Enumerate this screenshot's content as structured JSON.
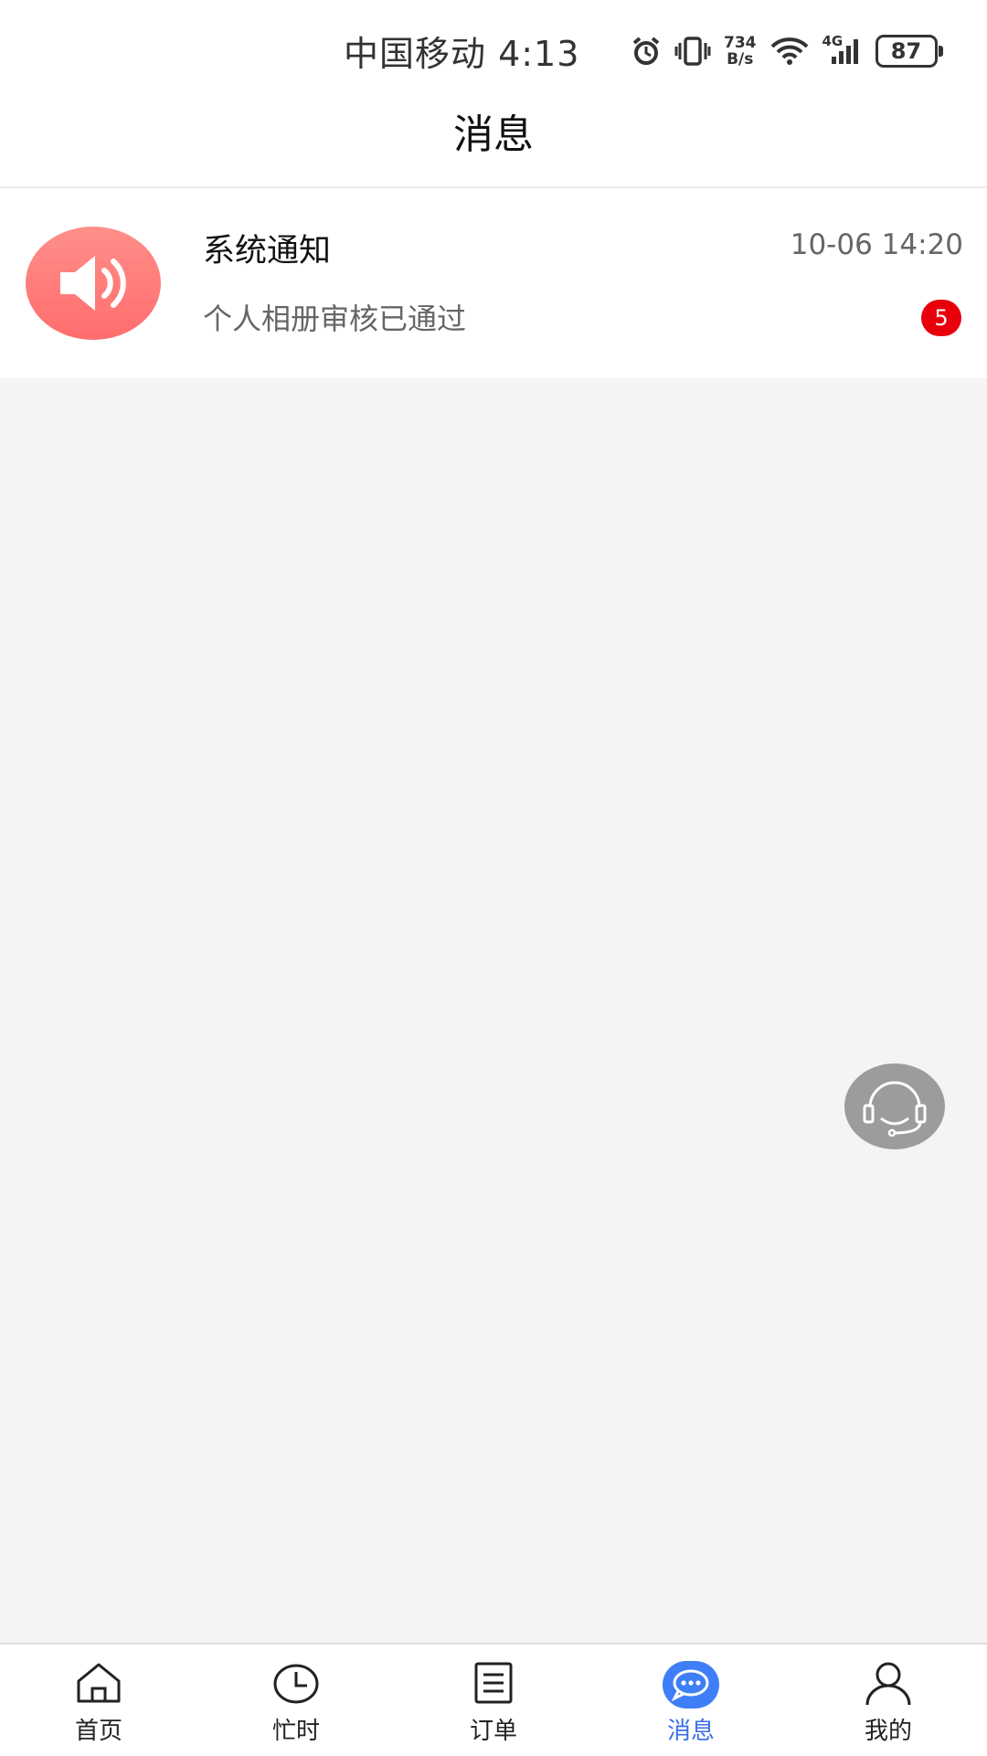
{
  "status_bar": {
    "carrier_time": "中国移动 4:13",
    "net_speed_value": "734",
    "net_speed_unit": "B/s",
    "network_type": "4G",
    "battery": "87",
    "icons": [
      "alarm-icon",
      "vibrate-icon",
      "wifi-icon",
      "signal-icon",
      "battery-icon"
    ]
  },
  "header": {
    "title": "消息"
  },
  "messages": [
    {
      "icon": "speaker-icon",
      "title": "系统通知",
      "time": "10-06 14:20",
      "preview": "个人相册审核已通过",
      "unread": "5"
    }
  ],
  "floating": {
    "icon": "headset-icon"
  },
  "tabs": [
    {
      "label": "首页",
      "icon": "home-icon"
    },
    {
      "label": "忙时",
      "icon": "clock-icon"
    },
    {
      "label": "订单",
      "icon": "list-icon"
    },
    {
      "label": "消息",
      "icon": "chat-bubble-icon",
      "active": true
    },
    {
      "label": "我的",
      "icon": "person-icon"
    }
  ],
  "colors": {
    "accent": "#3e7ef7",
    "badge": "#e7000b",
    "avatar_gradient_start": "#ff8f8a",
    "avatar_gradient_end": "#ff6d6d"
  }
}
